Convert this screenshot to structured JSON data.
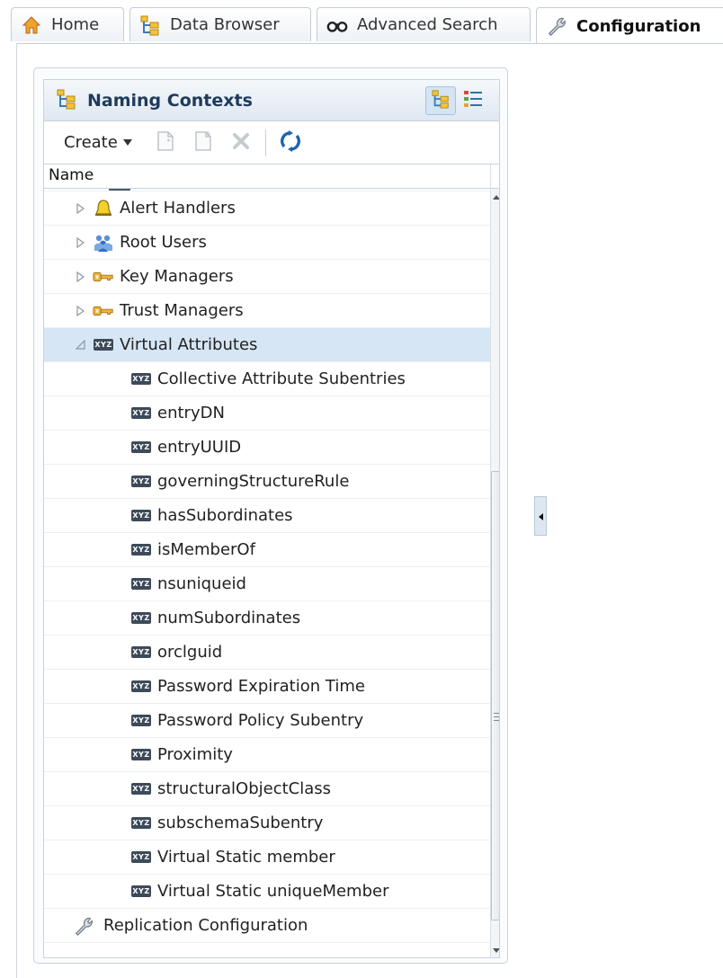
{
  "tabs": [
    {
      "label": "Home",
      "icon": "home-icon"
    },
    {
      "label": "Data Browser",
      "icon": "tree-icon"
    },
    {
      "label": "Advanced Search",
      "icon": "glasses-icon"
    },
    {
      "label": "Configuration",
      "icon": "wrench-icon",
      "active": true
    }
  ],
  "panel": {
    "title": "Naming Contexts",
    "toolbar": {
      "create_label": "Create"
    },
    "column_header": "Name"
  },
  "tree": {
    "rows": [
      {
        "label": "Alert Handlers",
        "icon": "bell-icon",
        "expander": "collapsed"
      },
      {
        "label": "Root Users",
        "icon": "users-icon",
        "expander": "collapsed"
      },
      {
        "label": "Key Managers",
        "icon": "key-icon",
        "expander": "collapsed"
      },
      {
        "label": "Trust Managers",
        "icon": "key-icon",
        "expander": "collapsed"
      },
      {
        "label": "Virtual Attributes",
        "icon": "xyz-icon",
        "expander": "expanded",
        "selected": true
      },
      {
        "label": "Collective Attribute Subentries",
        "icon": "xyz-icon"
      },
      {
        "label": "entryDN",
        "icon": "xyz-icon"
      },
      {
        "label": "entryUUID",
        "icon": "xyz-icon"
      },
      {
        "label": "governingStructureRule",
        "icon": "xyz-icon"
      },
      {
        "label": "hasSubordinates",
        "icon": "xyz-icon"
      },
      {
        "label": "isMemberOf",
        "icon": "xyz-icon"
      },
      {
        "label": "nsuniqueid",
        "icon": "xyz-icon"
      },
      {
        "label": "numSubordinates",
        "icon": "xyz-icon"
      },
      {
        "label": "orclguid",
        "icon": "xyz-icon"
      },
      {
        "label": "Password Expiration Time",
        "icon": "xyz-icon"
      },
      {
        "label": "Password Policy Subentry",
        "icon": "xyz-icon"
      },
      {
        "label": "Proximity",
        "icon": "xyz-icon"
      },
      {
        "label": "structuralObjectClass",
        "icon": "xyz-icon"
      },
      {
        "label": "subschemaSubentry",
        "icon": "xyz-icon"
      },
      {
        "label": "Virtual Static member",
        "icon": "xyz-icon"
      },
      {
        "label": "Virtual Static uniqueMember",
        "icon": "xyz-icon"
      },
      {
        "label": "Replication Configuration",
        "icon": "wrench-icon"
      }
    ],
    "xyz_icon_text": "XYZ"
  },
  "colors": {
    "selected_row": "#d7e6f5",
    "accent": "#1f3b5c"
  }
}
